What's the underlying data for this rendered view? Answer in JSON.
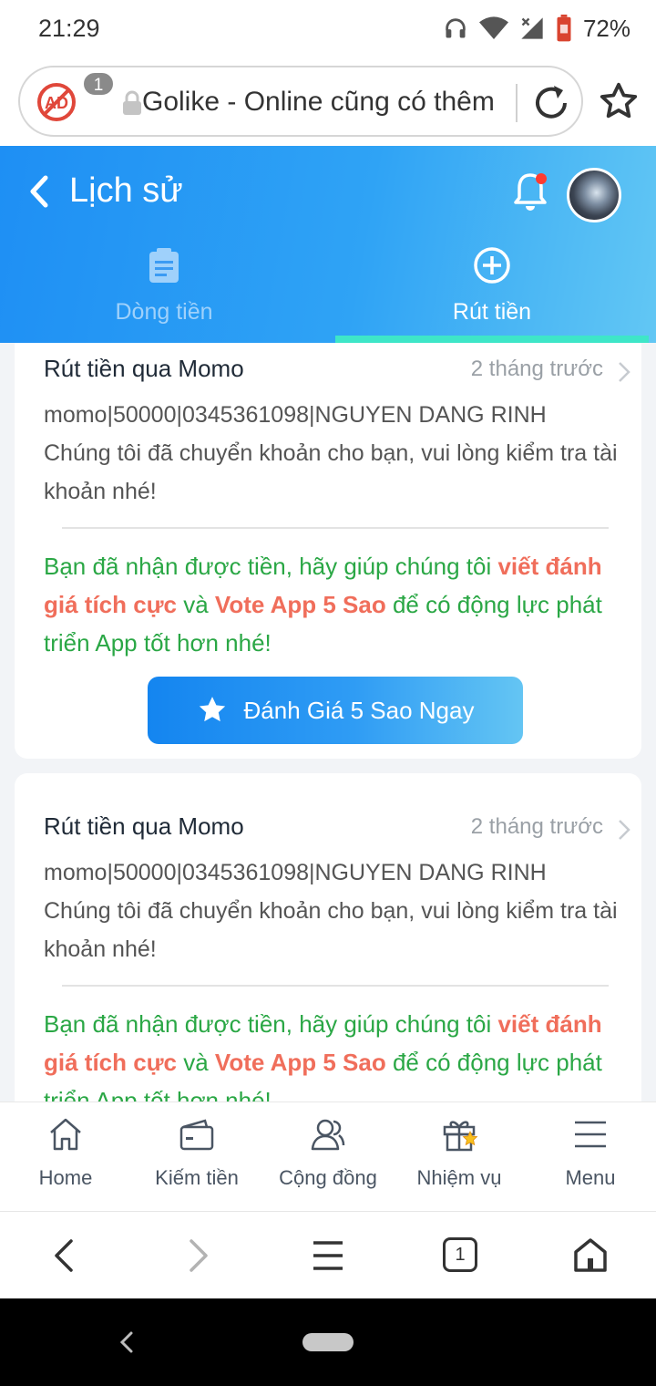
{
  "status_bar": {
    "time": "21:29",
    "battery": "72%"
  },
  "browser": {
    "url_text": "Golike - Online cũng có thêm",
    "ad_block_count": "1",
    "tab_count": "1"
  },
  "header": {
    "title": "Lịch sử"
  },
  "tabs": [
    {
      "label": "Dòng tiền",
      "active": false
    },
    {
      "label": "Rút tiền",
      "active": true
    }
  ],
  "cards": [
    {
      "title": "Rút tiền qua Momo",
      "time": "2 tháng trước",
      "line1": "momo|50000|0345361098|NGUYEN DANG RINH",
      "line2": "Chúng tôi đã chuyển khoản cho bạn, vui lòng kiểm tra tài khoản nhé!",
      "promo_part1": "Bạn đã nhận được tiền, hãy giúp chúng tôi ",
      "promo_highlight1": "viết đánh giá tích cực",
      "promo_part2": " và ",
      "promo_highlight2": "Vote App 5 Sao",
      "promo_part3": " để có động lực phát triển App tốt hơn nhé!",
      "button_label": "Đánh Giá 5 Sao Ngay"
    },
    {
      "title": "Rút tiền qua Momo",
      "time": "2 tháng trước",
      "line1": "momo|50000|0345361098|NGUYEN DANG RINH",
      "line2": "Chúng tôi đã chuyển khoản cho bạn, vui lòng kiểm tra tài khoản nhé!",
      "promo_part1": "Bạn đã nhận được tiền, hãy giúp chúng tôi ",
      "promo_highlight1": "viết đánh giá tích cực",
      "promo_part2": " và ",
      "promo_highlight2": "Vote App 5 Sao",
      "promo_part3": " để có động lực phát triển App tốt hơn nhé!"
    }
  ],
  "bottom_nav": [
    {
      "label": "Home",
      "icon": "home-icon"
    },
    {
      "label": "Kiếm tiền",
      "icon": "wallet-icon"
    },
    {
      "label": "Cộng đồng",
      "icon": "community-icon"
    },
    {
      "label": "Nhiệm vụ",
      "icon": "gift-icon"
    },
    {
      "label": "Menu",
      "icon": "menu-icon"
    }
  ],
  "colors": {
    "header_start": "#1e8ff4",
    "header_end": "#62c7f4",
    "tab_underline": "#3ee6c8",
    "promo_green": "#2aa745",
    "promo_highlight": "#f06e5b"
  }
}
